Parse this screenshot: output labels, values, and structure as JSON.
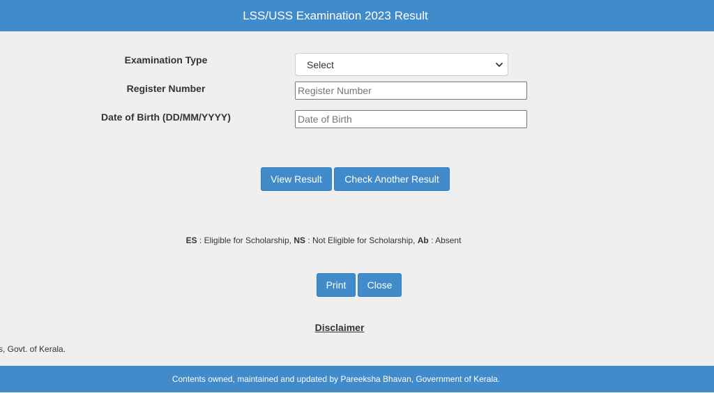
{
  "header": {
    "title": "LSS/USS Examination 2023 Result"
  },
  "form": {
    "exam_type_label": "Examination Type",
    "exam_type_selected": "Select",
    "register_label": "Register Number",
    "register_placeholder": "Register Number",
    "register_value": "",
    "dob_label": "Date of Birth (DD/MM/YYYY)",
    "dob_placeholder": "Date of Birth",
    "dob_value": ""
  },
  "actions": {
    "view_result": "View Result",
    "check_another": "Check Another Result",
    "print": "Print",
    "close": "Close"
  },
  "legend": {
    "es_abbr": "ES",
    "es_text": " : Eligible for Scholarship, ",
    "ns_abbr": "NS",
    "ns_text": " : Not Eligible for Scholarship, ",
    "ab_abbr": "Ab",
    "ab_text": " : Absent"
  },
  "disclaimer": {
    "heading": "Disclaimer",
    "text_fragment": "s, Govt. of Kerala."
  },
  "footer": {
    "text": "Contents owned, maintained and updated by Pareeksha Bhavan, Government of Kerala."
  },
  "colors": {
    "accent": "#428bca",
    "background": "#efefef"
  },
  "icons": {
    "select_arrow": "chevron-down-icon"
  }
}
